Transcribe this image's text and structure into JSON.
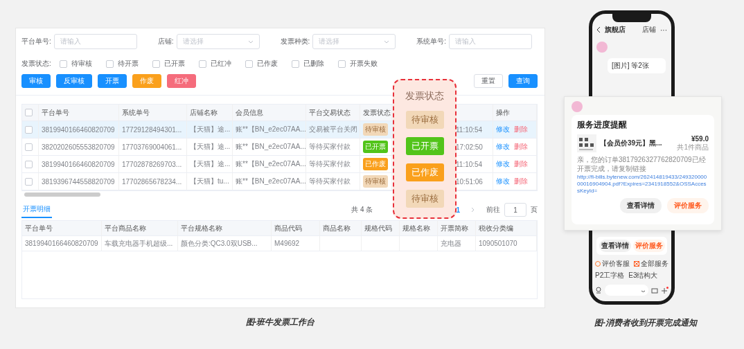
{
  "workbench": {
    "filters": [
      {
        "label": "平台单号:",
        "kind": "input",
        "placeholder": "请输入"
      },
      {
        "label": "店铺:",
        "kind": "select",
        "placeholder": "请选择"
      },
      {
        "label": "发票种类:",
        "kind": "select",
        "placeholder": "请选择"
      },
      {
        "label": "系统单号:",
        "kind": "input",
        "placeholder": "请输入"
      }
    ],
    "status_label": "发票状态:",
    "status_options": [
      {
        "label": "待审核",
        "checked": false
      },
      {
        "label": "待开票",
        "checked": false
      },
      {
        "label": "已开票",
        "checked": false
      },
      {
        "label": "已红冲",
        "checked": false
      },
      {
        "label": "已作废",
        "checked": false
      },
      {
        "label": "已删除",
        "checked": false
      },
      {
        "label": "开票失败",
        "checked": false
      }
    ],
    "actions": [
      {
        "label": "审核",
        "kind": "primary"
      },
      {
        "label": "反审核",
        "kind": "primary"
      },
      {
        "label": "开票",
        "kind": "primary"
      },
      {
        "label": "作废",
        "kind": "warning"
      },
      {
        "label": "红冲",
        "kind": "danger"
      }
    ],
    "query_buttons": [
      {
        "label": "重置",
        "kind": "plain"
      },
      {
        "label": "查询",
        "kind": "primary"
      }
    ],
    "orders_table": {
      "header_checked": false,
      "columns": {
        "platform_no": "平台单号",
        "system_no": "系统单号",
        "shop": "店铺名称",
        "member": "会员信息",
        "trade_status": "平台交易状态",
        "invoice_status": "发票状态",
        "actions": "操作"
      },
      "rows": [
        {
          "selected": true,
          "checked": false,
          "platform_no": "3819940166460820709",
          "system_no": "17729128494301...",
          "shop": "【天猫】途...",
          "member": "账**【BN_e2ec07AA...",
          "trade_status": "交易被平台关闭",
          "invoice_status": {
            "label": "待审核",
            "kind": "pending"
          },
          "column_7": "11:10:54",
          "actions": [
            {
              "label": "修改",
              "kind": "edit"
            },
            {
              "label": "删除",
              "kind": "delete"
            }
          ]
        },
        {
          "selected": false,
          "checked": false,
          "platform_no": "3820202605553820709",
          "system_no": "17703769004061...",
          "shop": "【天猫】途...",
          "member": "账**【BN_e2ec07AA...",
          "trade_status": "等待买家付款",
          "invoice_status": {
            "label": "已开票",
            "kind": "issued"
          },
          "column_7": "17:02:50",
          "actions": [
            {
              "label": "修改",
              "kind": "edit"
            },
            {
              "label": "删除",
              "kind": "delete"
            }
          ]
        },
        {
          "selected": false,
          "checked": false,
          "platform_no": "3819940166460820709",
          "system_no": "17702878269703...",
          "shop": "【天猫】途...",
          "member": "账**【BN_e2ec07AA...",
          "trade_status": "等待买家付款",
          "invoice_status": {
            "label": "已作废",
            "kind": "voided"
          },
          "column_7": "11:10:54",
          "actions": [
            {
              "label": "修改",
              "kind": "edit"
            },
            {
              "label": "删除",
              "kind": "delete"
            }
          ]
        },
        {
          "selected": false,
          "checked": false,
          "platform_no": "3819396744558820709",
          "system_no": "17702865678234...",
          "shop": "【天猫】tu...",
          "member": "账**【BN_e2ec07AA...",
          "trade_status": "等待买家付款",
          "invoice_status": {
            "label": "待审核",
            "kind": "pending"
          },
          "column_7": "10:51:06",
          "actions": [
            {
              "label": "修改",
              "kind": "edit"
            },
            {
              "label": "删除",
              "kind": "delete"
            }
          ]
        }
      ]
    },
    "pagination": {
      "total": "共 4 条",
      "pages": [
        {
          "label": "1",
          "selected": true
        }
      ],
      "goto_label": "前往",
      "goto_value": "1",
      "page_unit": "页"
    },
    "detail_tabs": [
      {
        "label": "开票明细",
        "selected": true
      }
    ],
    "detail_table": {
      "columns": [
        "平台单号",
        "平台商品名称",
        "平台规格名称",
        "商品代码",
        "商品名称",
        "规格代码",
        "规格名称",
        "开票简称",
        "税收分类编"
      ],
      "rows": [
        [
          "3819940166460820709",
          "车载充电器手机超级...",
          "颜色分类:QC3.0双USB...",
          "M49692",
          null,
          null,
          null,
          "充电器",
          "1090501070"
        ]
      ]
    },
    "callout": {
      "title": "发票状态",
      "tags": [
        {
          "label": "待审核",
          "kind": "pending"
        },
        {
          "label": "已开票",
          "kind": "issued"
        },
        {
          "label": "已作废",
          "kind": "voided"
        },
        {
          "label": "待审核",
          "kind": "pending"
        }
      ]
    },
    "caption": "图-班牛发票工作台"
  },
  "phone": {
    "header": {
      "title": "旗舰店",
      "shop_link": "店铺",
      "more": "···"
    },
    "image_bubble": "[图片] 等2张",
    "bubble_buttons": [
      {
        "label": "查看详情",
        "kind": "plain"
      },
      {
        "label": "评价服务",
        "kind": "accent"
      }
    ],
    "chips": [
      {
        "label": "评价客服",
        "kind": "rate"
      },
      {
        "label": "全部服务",
        "kind": "all"
      },
      {
        "label": "P2工字格"
      },
      {
        "label": "E3结构大"
      }
    ],
    "notification": {
      "title": "服务进度提醒",
      "product": "【会员价39元】黑...",
      "price": "¥59.0",
      "count": "共1件商品",
      "message": "亲，您的订单3817926327762820709已经开票完成，请复制链接",
      "link": "http://fi-bills.bytenew.com/262414819433/24932000000016904904.pdf?Expires=2341918552&OSSAccessKeyId=",
      "buttons": [
        {
          "label": "查看详情",
          "kind": "plain"
        },
        {
          "label": "评价服务",
          "kind": "accent"
        }
      ]
    },
    "caption": "图-消费者收到开票完成通知"
  }
}
